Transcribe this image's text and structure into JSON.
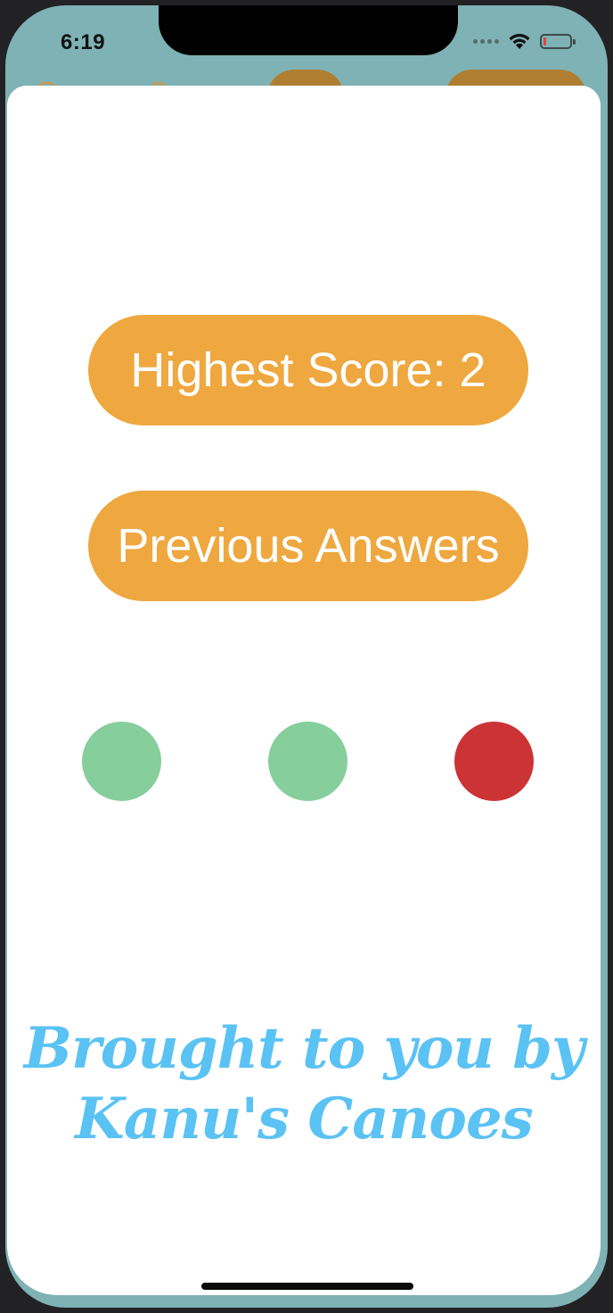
{
  "status_bar": {
    "time": "6:19",
    "icons": [
      "cellular-signal-icon",
      "wifi-icon",
      "battery-low-icon"
    ]
  },
  "background_screen": {
    "score_label": "Score: 2"
  },
  "sheet": {
    "highest_score_button": "Highest Score: 2",
    "previous_answers_button": "Previous Answers",
    "answer_indicators": [
      {
        "status": "correct",
        "color": "#86ce9b"
      },
      {
        "status": "correct",
        "color": "#86ce9b"
      },
      {
        "status": "incorrect",
        "color": "#cc3335"
      }
    ],
    "credit_line_1": "Brought to you by",
    "credit_line_2": "Kanu's Canoes"
  },
  "colors": {
    "button": "#eea83f",
    "credit_text": "#5bc2f4",
    "background_teal": "#7eb2b5"
  }
}
